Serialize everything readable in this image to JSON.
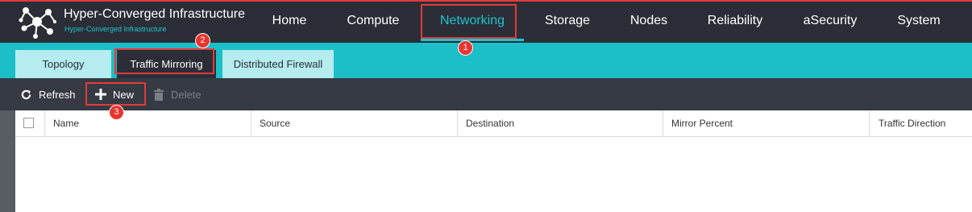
{
  "brand": {
    "title": "Hyper-Converged Infrastructure",
    "subtitle": "Hyper-Converged Infrastructure"
  },
  "nav": {
    "items": [
      {
        "label": "Home"
      },
      {
        "label": "Compute"
      },
      {
        "label": "Networking",
        "active": true
      },
      {
        "label": "Storage"
      },
      {
        "label": "Nodes"
      },
      {
        "label": "Reliability"
      },
      {
        "label": "aSecurity"
      },
      {
        "label": "System"
      }
    ]
  },
  "subtabs": {
    "items": [
      {
        "label": "Topology"
      },
      {
        "label": "Traffic Mirroring",
        "active": true
      },
      {
        "label": "Distributed Firewall"
      }
    ]
  },
  "toolbar": {
    "refresh_label": "Refresh",
    "new_label": "New",
    "delete_label": "Delete"
  },
  "table": {
    "columns": [
      "Name",
      "Source",
      "Destination",
      "Mirror Percent",
      "Traffic Direction"
    ],
    "rows": []
  },
  "annotations": {
    "step1": "1",
    "step2": "2",
    "step3": "3"
  },
  "colors": {
    "topbar": "#2b2e36",
    "accent_teal": "#1cbec7",
    "highlight_red": "#e23b3b",
    "toolbar": "#363a43"
  }
}
